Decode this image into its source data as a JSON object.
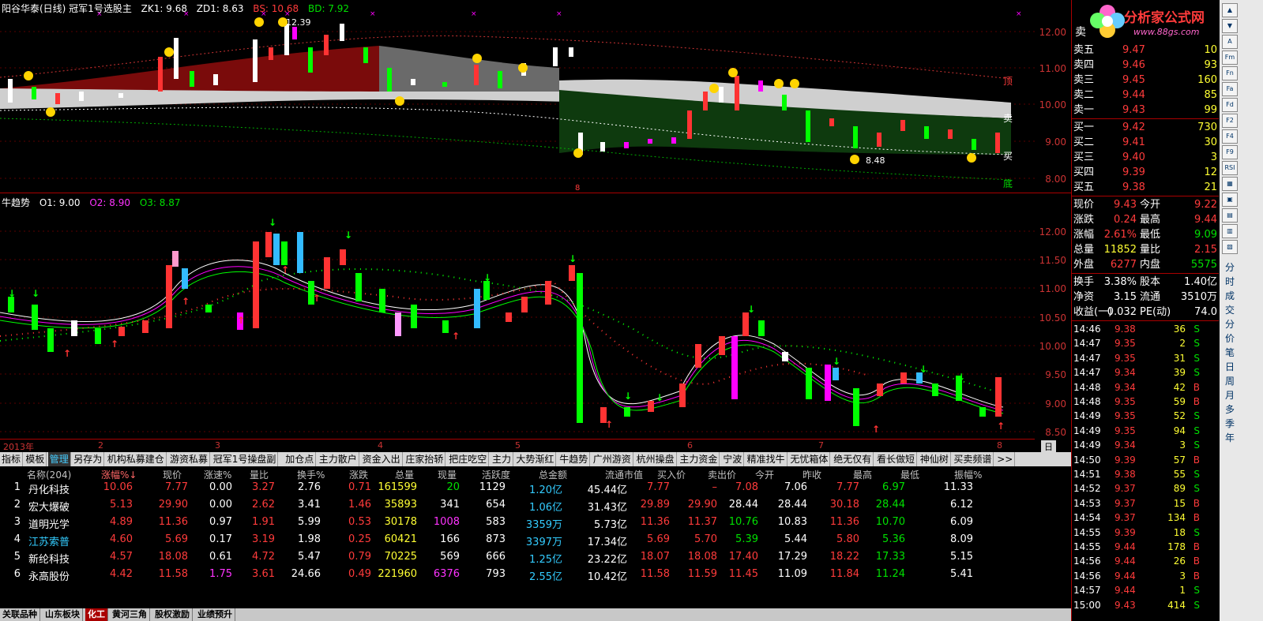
{
  "top_chart": {
    "title": "阳谷华泰(日线) 冠军1号选股主",
    "zk1": "ZK1: 9.68",
    "zd1": "ZD1: 8.63",
    "bs": "BS: 10.68",
    "bd": "BD: 7.92",
    "annot_high": "12.39",
    "annot_low": "8.48",
    "annot_8": "8",
    "label_top": "顶",
    "label_sell": "卖",
    "label_buy": "买",
    "label_bottom": "底",
    "yticks": [
      "12.00",
      "11.00",
      "10.00",
      "9.00",
      "8.00"
    ],
    "colors": {
      "red_band": "#7a0b0b",
      "green_band": "#0e3a0e",
      "gray_band": "#cfcfcf",
      "dark_gray": "#6a6a6a"
    }
  },
  "mid_chart": {
    "title": "牛趋势",
    "o1": "O1: 9.00",
    "o2": "O2: 8.90",
    "o3": "O3: 8.87",
    "yticks": [
      "12.00",
      "11.50",
      "11.00",
      "10.50",
      "10.00",
      "9.50",
      "9.00",
      "8.50"
    ]
  },
  "date_axis": {
    "labels": [
      "2013年",
      "2",
      "3",
      "4",
      "5",
      "6",
      "7",
      "8"
    ],
    "period": "日线"
  },
  "tabs": [
    "指标",
    "模板",
    "管理",
    "另存为",
    "机构私募建仓",
    "游资私募",
    "冠军1号操盘副",
    "加仓点",
    "主力散户",
    "资金入出",
    "庄家抬轿",
    "把庄吃空",
    "主力",
    "大势渐红",
    "牛趋势",
    "广州游资",
    "杭州操盘",
    "主力资金",
    "宁波",
    "精准找牛",
    "无忧箱体",
    "绝无仅有",
    "看长做短",
    "神仙树",
    "买卖频谱",
    ">>"
  ],
  "active_tab": "管理",
  "table": {
    "headers": [
      "名称(204)",
      "涨幅%↓",
      "现价",
      "涨速%",
      "量比",
      "换手%",
      "涨跌",
      "总量",
      "现量",
      "活跃度",
      "总金额",
      "流通市值",
      "买入价",
      "卖出价",
      "今开",
      "昨收",
      "最高",
      "最低",
      "振幅%"
    ],
    "rows": [
      [
        "1",
        "丹化科技",
        "10.06",
        "7.77",
        "0.00",
        "3.27",
        "2.76",
        "0.71",
        "161599",
        "20",
        "1129",
        "1.20亿",
        "45.44亿",
        "7.77",
        "–",
        "7.08",
        "7.06",
        "7.77",
        "6.97",
        "11.33"
      ],
      [
        "2",
        "宏大爆破",
        "5.13",
        "29.90",
        "0.00",
        "2.62",
        "3.41",
        "1.46",
        "35893",
        "341",
        "654",
        "1.06亿",
        "31.43亿",
        "29.89",
        "29.90",
        "28.44",
        "28.44",
        "30.18",
        "28.44",
        "6.12"
      ],
      [
        "3",
        "道明光学",
        "4.89",
        "11.36",
        "0.97",
        "1.91",
        "5.99",
        "0.53",
        "30178",
        "1008",
        "583",
        "3359万",
        "5.73亿",
        "11.36",
        "11.37",
        "10.76",
        "10.83",
        "11.36",
        "10.70",
        "6.09"
      ],
      [
        "4",
        "江苏索普",
        "4.60",
        "5.69",
        "0.17",
        "3.19",
        "1.98",
        "0.25",
        "60421",
        "166",
        "873",
        "3397万",
        "17.34亿",
        "5.69",
        "5.70",
        "5.39",
        "5.44",
        "5.80",
        "5.36",
        "8.09"
      ],
      [
        "5",
        "新纶科技",
        "4.57",
        "18.08",
        "0.61",
        "4.72",
        "5.47",
        "0.79",
        "70225",
        "569",
        "666",
        "1.25亿",
        "23.22亿",
        "18.07",
        "18.08",
        "17.40",
        "17.29",
        "18.22",
        "17.33",
        "5.15"
      ],
      [
        "6",
        "永高股份",
        "4.42",
        "11.58",
        "1.75",
        "3.61",
        "24.66",
        "0.49",
        "221960",
        "6376",
        "793",
        "2.55亿",
        "10.42亿",
        "11.58",
        "11.59",
        "11.45",
        "11.09",
        "11.84",
        "11.24",
        "5.41"
      ]
    ]
  },
  "bottom_tabs": [
    "关联品种",
    "山东板块",
    "化工",
    "黄河三角",
    "股权激励",
    "业绩预升"
  ],
  "bottom_active": "化工",
  "logo": {
    "text": "分析家公式网",
    "url_text": "www.88gs.com"
  },
  "quote": {
    "sell": [
      [
        "卖五",
        "9.47",
        "10"
      ],
      [
        "卖四",
        "9.46",
        "93"
      ],
      [
        "卖三",
        "9.45",
        "160"
      ],
      [
        "卖二",
        "9.44",
        "85"
      ],
      [
        "卖一",
        "9.43",
        "99"
      ]
    ],
    "sell_top_label": "卖",
    "buy": [
      [
        "买一",
        "9.42",
        "730"
      ],
      [
        "买二",
        "9.41",
        "30"
      ],
      [
        "买三",
        "9.40",
        "3"
      ],
      [
        "买四",
        "9.39",
        "12"
      ],
      [
        "买五",
        "9.38",
        "21"
      ]
    ],
    "stats": [
      [
        "现价",
        "9.43",
        "今开",
        "9.22"
      ],
      [
        "涨跌",
        "0.24",
        "最高",
        "9.44"
      ],
      [
        "涨幅",
        "2.61%",
        "最低",
        "9.09"
      ],
      [
        "总量",
        "11852",
        "量比",
        "2.15"
      ],
      [
        "外盘",
        "6277",
        "内盘",
        "5575"
      ]
    ],
    "stats2": [
      [
        "换手",
        "3.38%",
        "股本",
        "1.40亿"
      ],
      [
        "净资",
        "3.15",
        "流通",
        "3510万"
      ],
      [
        "收益(一)",
        "0.032",
        "PE(动)",
        "74.0"
      ]
    ],
    "ticks": [
      [
        "14:46",
        "9.38",
        "36",
        "S"
      ],
      [
        "14:47",
        "9.35",
        "2",
        "S"
      ],
      [
        "14:47",
        "9.35",
        "31",
        "S"
      ],
      [
        "14:47",
        "9.34",
        "39",
        "S"
      ],
      [
        "14:48",
        "9.34",
        "42",
        "B"
      ],
      [
        "14:48",
        "9.35",
        "59",
        "B"
      ],
      [
        "14:49",
        "9.35",
        "52",
        "S"
      ],
      [
        "14:49",
        "9.35",
        "94",
        "S"
      ],
      [
        "14:49",
        "9.34",
        "3",
        "S"
      ],
      [
        "14:50",
        "9.39",
        "57",
        "B"
      ],
      [
        "14:51",
        "9.38",
        "55",
        "S"
      ],
      [
        "14:52",
        "9.37",
        "89",
        "S"
      ],
      [
        "14:53",
        "9.37",
        "15",
        "B"
      ],
      [
        "14:54",
        "9.37",
        "134",
        "B"
      ],
      [
        "14:55",
        "9.39",
        "18",
        "S"
      ],
      [
        "14:55",
        "9.44",
        "178",
        "B"
      ],
      [
        "14:56",
        "9.44",
        "26",
        "B"
      ],
      [
        "14:56",
        "9.44",
        "3",
        "B"
      ],
      [
        "14:57",
        "9.44",
        "1",
        "S"
      ],
      [
        "15:00",
        "9.43",
        "414",
        "S"
      ]
    ]
  },
  "side_tools": [
    "▲",
    "▼",
    "A",
    "Fm",
    "Fn",
    "Fa",
    "Fd",
    "F2",
    "F4",
    "F9",
    "RSI",
    "▦",
    "▣",
    "▤",
    "▥",
    "▧"
  ],
  "side_vtabs": [
    "分",
    "时",
    "成",
    "交",
    "分",
    "价",
    "笔",
    "日",
    "周",
    "月",
    "多",
    "季",
    "年"
  ]
}
